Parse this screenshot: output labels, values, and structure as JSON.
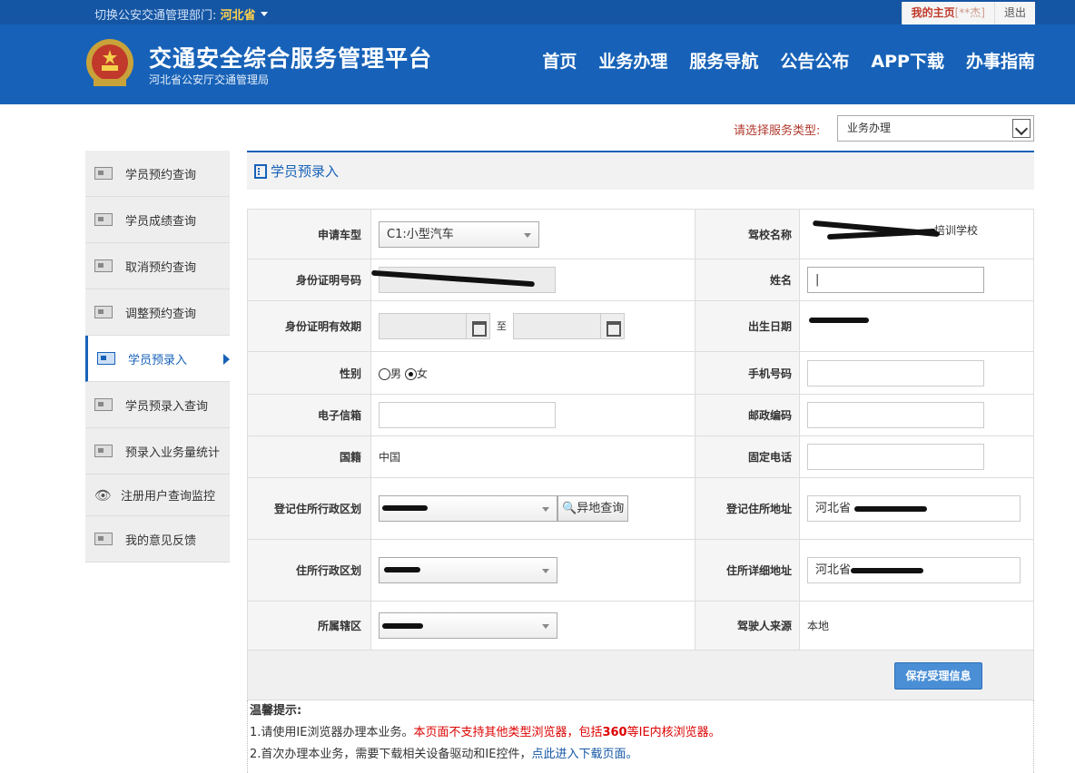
{
  "topbar": {
    "switch_label": "切换公安交通管理部门:",
    "province": "河北省",
    "home_label": "我的主页",
    "home_user": "[**杰]",
    "logout": "退出"
  },
  "header": {
    "title": "交通安全综合服务管理平台",
    "subtitle": "河北省公安厅交通管理局",
    "nav": [
      "首页",
      "业务办理",
      "服务导航",
      "公告公布",
      "APP下载",
      "办事指南"
    ]
  },
  "service": {
    "label": "请选择服务类型:",
    "value": "业务办理"
  },
  "sidebar": {
    "items": [
      {
        "label": "学员预约查询",
        "icon": "id-card-icon"
      },
      {
        "label": "学员成绩查询",
        "icon": "id-card-icon"
      },
      {
        "label": "取消预约查询",
        "icon": "id-card-icon"
      },
      {
        "label": "调整预约查询",
        "icon": "id-card-icon"
      },
      {
        "label": "学员预录入",
        "icon": "id-card-icon",
        "active": true
      },
      {
        "label": "学员预录入查询",
        "icon": "id-card-icon"
      },
      {
        "label": "预录入业务量统计",
        "icon": "id-card-icon"
      },
      {
        "label": "注册用户查询监控",
        "icon": "eye-icon"
      },
      {
        "label": "我的意见反馈",
        "icon": "feedback-icon"
      }
    ]
  },
  "page": {
    "title": "学员预录入"
  },
  "form": {
    "vehicle_type_label": "申请车型",
    "vehicle_type_value": "C1:小型汽车",
    "school_label": "驾校名称",
    "school_value": "培训学校",
    "id_number_label": "身份证明号码",
    "name_label": "姓名",
    "id_valid_label": "身份证明有效期",
    "id_valid_to": "至",
    "birth_label": "出生日期",
    "gender_label": "性别",
    "gender_male": "男",
    "gender_female": "女",
    "phone_label": "手机号码",
    "email_label": "电子信箱",
    "postcode_label": "邮政编码",
    "nationality_label": "国籍",
    "nationality_value": "中国",
    "landline_label": "固定电话",
    "reg_district_label": "登记住所行政区划",
    "remote_query": "异地查询",
    "reg_address_label": "登记住所地址",
    "reg_address_value": "河北省",
    "res_district_label": "住所行政区划",
    "res_address_label": "住所详细地址",
    "res_address_value": "河北省",
    "jurisdiction_label": "所属辖区",
    "source_label": "驾驶人来源",
    "source_value": "本地"
  },
  "save_button": "保存受理信息",
  "tips": {
    "title": "温馨提示:",
    "line1_a": "1.请使用IE浏览器办理本业务。",
    "line1_b": "本页面不支持其他类型浏览器，包括",
    "line1_c": "360",
    "line1_d": "等IE内核浏览器。",
    "line2_a": "2.首次办理本业务，需要下载相关设备驱动和IE控件，",
    "line2_b": "点此进入下载页面。"
  },
  "colors": {
    "header_blue": "#1762b8",
    "topbar_blue": "#1556a4",
    "province_yellow": "#ffd24a",
    "warning_red": "#dd0000",
    "save_button": "#4a8fd6"
  }
}
